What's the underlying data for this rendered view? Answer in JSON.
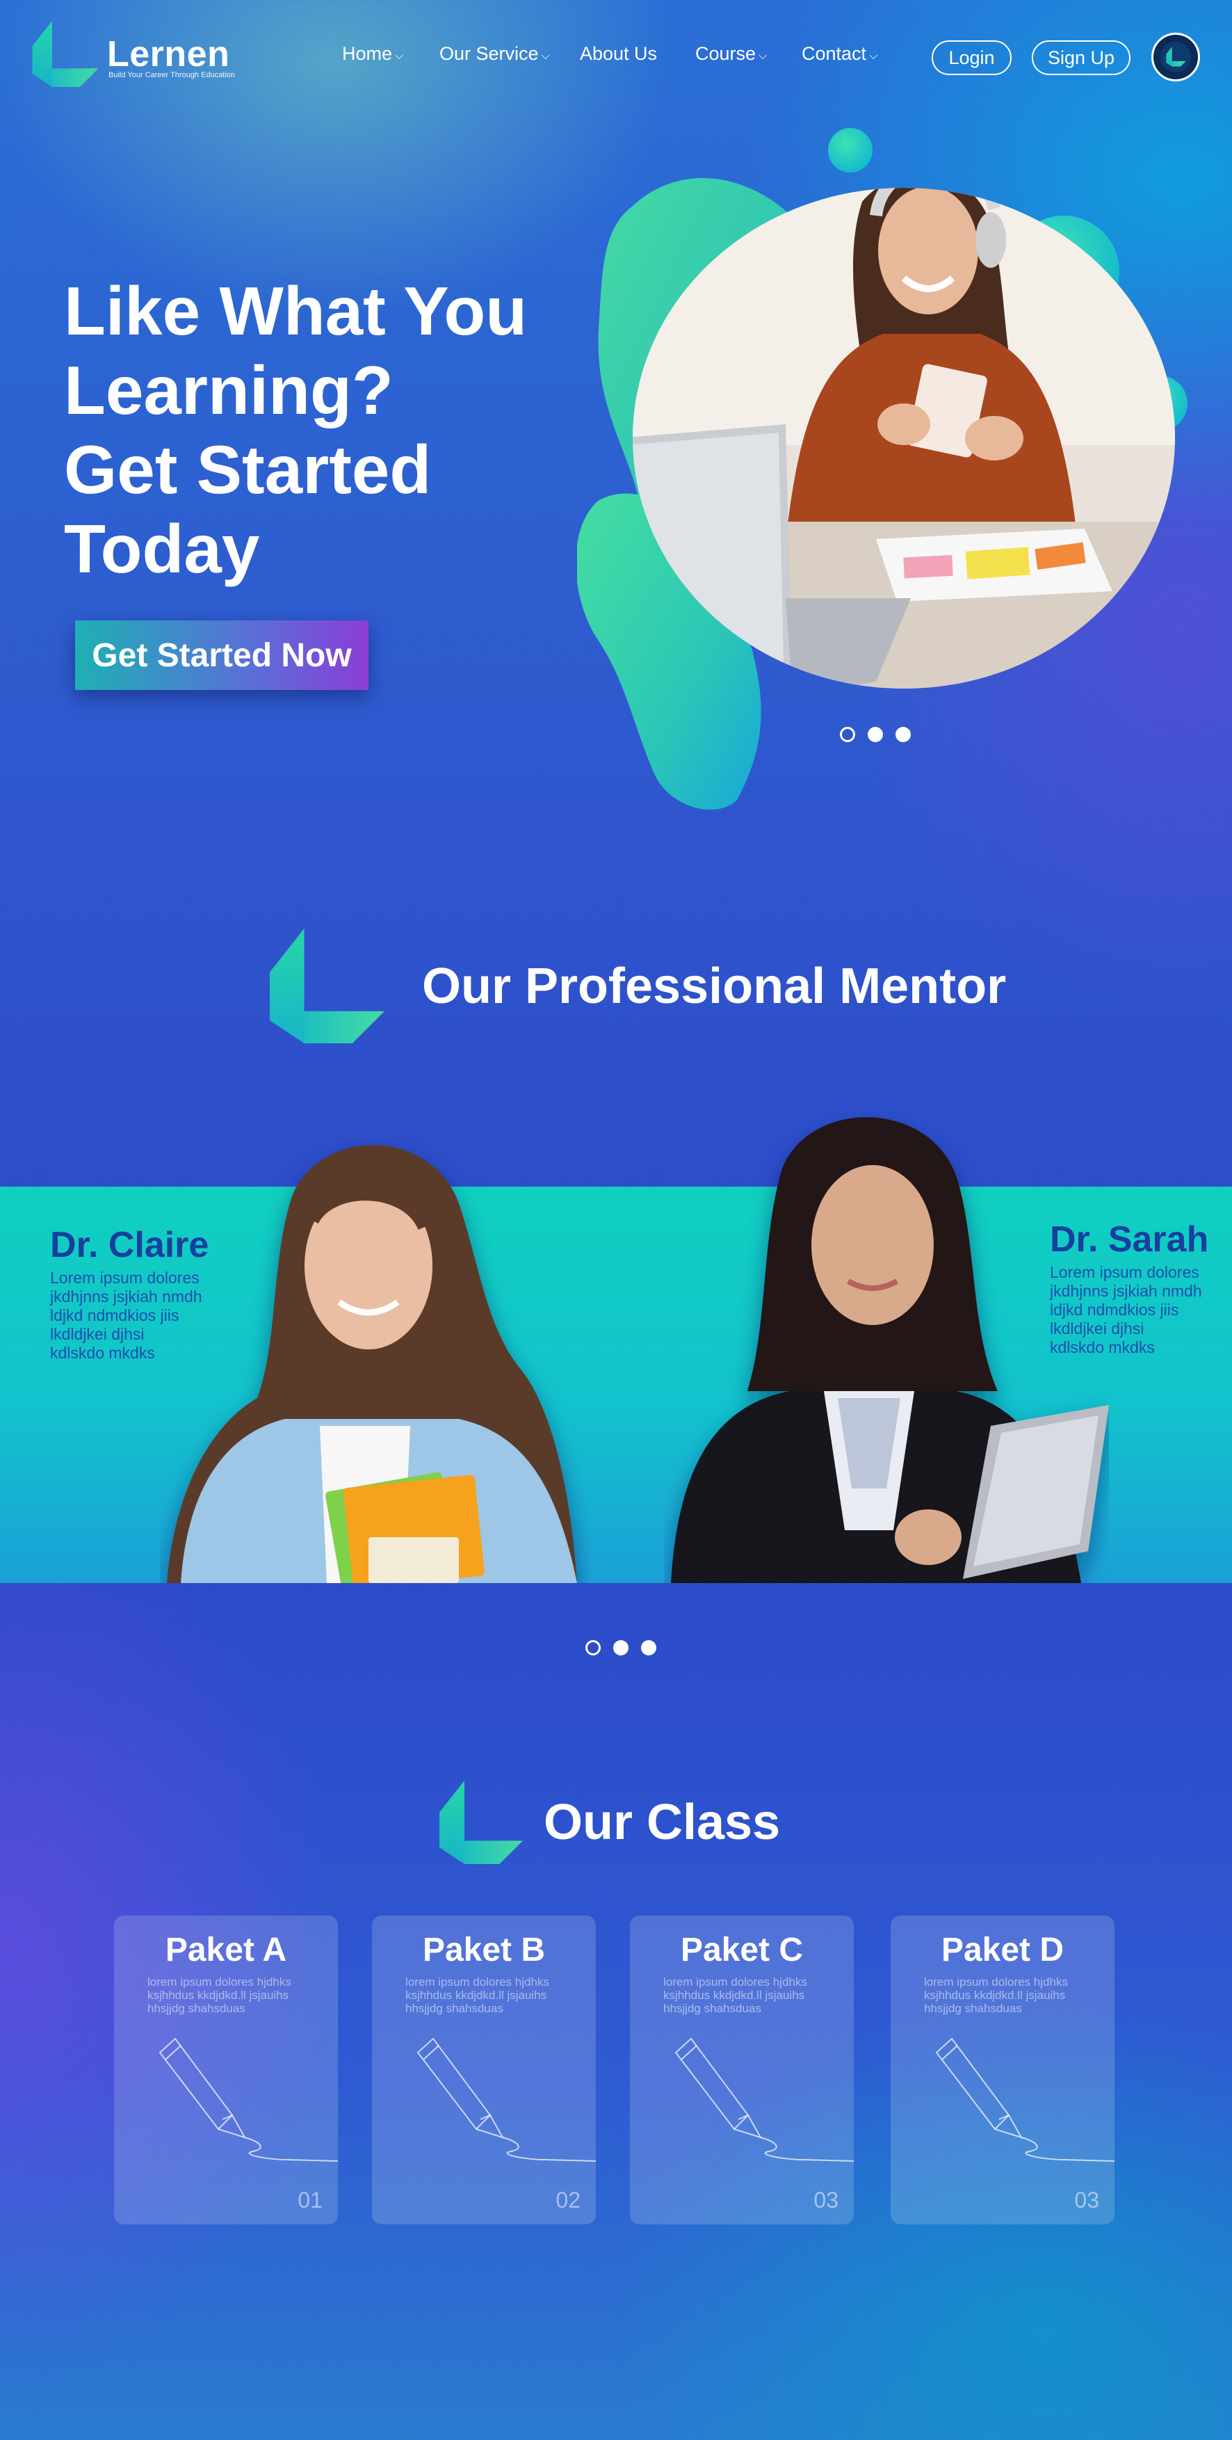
{
  "brand": {
    "name": "Lernen",
    "tagline": "Build Your Career Through Education",
    "colors": {
      "teal": "#12d0b8",
      "blue": "#2b4fc8",
      "purple": "#7a3fd6",
      "dark_text": "#173f9e"
    }
  },
  "nav": {
    "items": [
      {
        "label": "Home",
        "has_dropdown": true
      },
      {
        "label": "Our Service",
        "has_dropdown": true
      },
      {
        "label": "About Us",
        "has_dropdown": false
      },
      {
        "label": "Course",
        "has_dropdown": true
      },
      {
        "label": "Contact",
        "has_dropdown": true
      }
    ],
    "dropdown_icon": "chevron-down-icon",
    "login_label": "Login",
    "signup_label": "Sign Up",
    "profile_icon": "logo-avatar-icon"
  },
  "hero": {
    "title_lines": [
      "Like What You",
      "Learning?",
      "Get Started",
      "Today"
    ],
    "cta_label": "Get Started Now",
    "slider": {
      "total": 3,
      "active_index": 0
    }
  },
  "mentors": {
    "title": "Our Professional Mentor",
    "people": [
      {
        "name": "Dr. Claire",
        "desc_lines": [
          "Lorem ipsum dolores",
          "jkdhjnns jsjkiah nmdh",
          "ldjkd ndmdkios jiis",
          "lkdldjkei djhsi",
          "kdlskdo mkdks"
        ]
      },
      {
        "name": "Dr. Sarah",
        "desc_lines": [
          "Lorem ipsum dolores",
          "jkdhjnns jsjkiah nmdh",
          "ldjkd ndmdkios jiis",
          "lkdldjkei djhsi",
          "kdlskdo mkdks"
        ]
      }
    ],
    "slider": {
      "total": 3,
      "active_index": 0
    }
  },
  "classes": {
    "title": "Our Class",
    "cards": [
      {
        "title": "Paket A",
        "desc_lines": [
          "lorem ipsum dolores hjdhks",
          "ksjhhdus kkdjdkd.ll jsjauihs",
          "hhsjjdg shahsduas"
        ],
        "number": "01"
      },
      {
        "title": "Paket B",
        "desc_lines": [
          "lorem ipsum dolores hjdhks",
          "ksjhhdus kkdjdkd.ll jsjauihs",
          "hhsjjdg shahsduas"
        ],
        "number": "02"
      },
      {
        "title": "Paket C",
        "desc_lines": [
          "lorem ipsum dolores hjdhks",
          "ksjhhdus kkdjdkd.ll jsjauihs",
          "hhsjjdg shahsduas"
        ],
        "number": "03"
      },
      {
        "title": "Paket D",
        "desc_lines": [
          "lorem ipsum dolores hjdhks",
          "ksjhhdus kkdjdkd.ll jsjauihs",
          "hhsjjdg shahsduas"
        ],
        "number": "03"
      }
    ],
    "card_icon": "pencil-icon"
  }
}
